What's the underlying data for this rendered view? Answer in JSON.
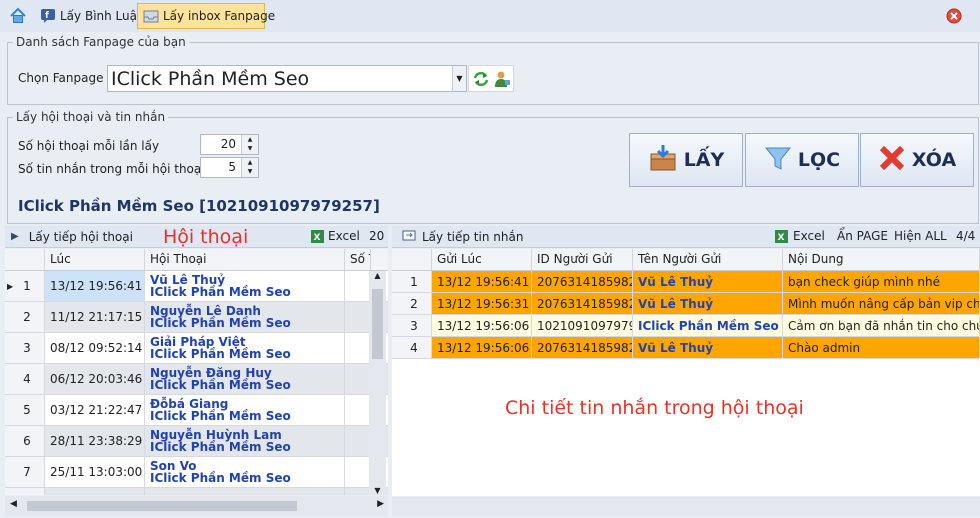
{
  "tabs": {
    "comments": "Lấy Bình Luận",
    "inbox": "Lấy inbox Fanpage"
  },
  "fanpage_group": {
    "legend": "Danh sách Fanpage của bạn",
    "label": "Chọn Fanpage",
    "selected": "IClick Phần Mềm Seo"
  },
  "convo_group": {
    "legend": "Lấy hội thoại và tin nhắn",
    "per_fetch_label": "Số hội thoại mỗi lần lấy",
    "per_fetch_value": "20",
    "msgs_label": "Số tin nhắn trong mỗi hội thoại",
    "msgs_value": "5"
  },
  "page_heading": "IClick Phần Mềm Seo [1021091097979257]",
  "buttons": {
    "get": "LẤY",
    "filter": "LỌC",
    "delete": "XÓA"
  },
  "left_panel": {
    "next_label": "Lấy tiếp hội thoại",
    "annotation": "Hội thoại",
    "excel": "Excel",
    "count": "20",
    "columns": [
      "Lúc",
      "Hội Thoại",
      "Số T"
    ],
    "rows": [
      {
        "n": "1",
        "time": "13/12 19:56:41",
        "name": "Vũ Lê Thuỷ",
        "page": "IClick Phần Mềm Seo"
      },
      {
        "n": "2",
        "time": "11/12 21:17:15",
        "name": "Nguyễn Lê Danh",
        "page": "IClick Phần Mềm Seo"
      },
      {
        "n": "3",
        "time": "08/12 09:52:14",
        "name": "Giải Pháp Việt",
        "page": "IClick Phần Mềm Seo"
      },
      {
        "n": "4",
        "time": "06/12 20:03:46",
        "name": "Nguyễn Đăng Huy",
        "page": "IClick Phần Mềm Seo"
      },
      {
        "n": "5",
        "time": "03/12 21:22:47",
        "name": "Đỗbá Giang",
        "page": "IClick Phần Mềm Seo"
      },
      {
        "n": "6",
        "time": "28/11 23:38:29",
        "name": "Nguyễn Huỳnh Lam",
        "page": "IClick Phần Mềm Seo"
      },
      {
        "n": "7",
        "time": "25/11 13:03:00",
        "name": "Son Vo",
        "page": "IClick Phần Mềm Seo"
      }
    ]
  },
  "right_panel": {
    "next_label": "Lấy tiếp tin nhắn",
    "excel": "Excel",
    "hide_page": "Ẩn PAGE",
    "show_all": "Hiện ALL",
    "count": "4/4",
    "annotation": "Chi tiết tin nhắn trong hội thoại",
    "columns": [
      "Gửi Lúc",
      "ID Người Gửi",
      "Tên Người Gửi",
      "Nội Dung"
    ],
    "rows": [
      {
        "n": "1",
        "time": "13/12 19:56:41",
        "id": "2076314185982...",
        "sender": "Vũ Lê Thuỷ",
        "content": "bạn check giúp mình nhé"
      },
      {
        "n": "2",
        "time": "13/12 19:56:31",
        "id": "2076314185982...",
        "sender": "Vũ Lê Thuỷ",
        "content": "Mình muốn nâng cấp bản vip ch..."
      },
      {
        "n": "3",
        "time": "13/12 19:56:06",
        "id": "1021091097979...",
        "sender": "IClick Phần Mềm Seo",
        "content": "Cảm ơn bạn đã nhắn tin cho chú..."
      },
      {
        "n": "4",
        "time": "13/12 19:56:06",
        "id": "2076314185982...",
        "sender": "Vũ Lê Thuỷ",
        "content": "Chào admin"
      }
    ]
  },
  "colors": {
    "orange_row": "#ffa500",
    "page_row": "#fffde0",
    "annotation": "#e5332a",
    "link_blue": "#2143b0"
  }
}
